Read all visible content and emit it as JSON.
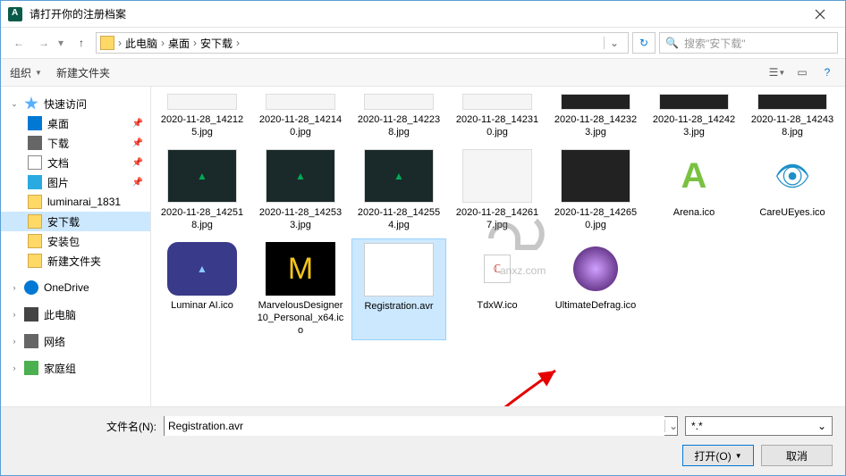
{
  "window": {
    "title": "请打开你的注册档案"
  },
  "nav": {
    "crumbs": [
      "此电脑",
      "桌面",
      "安下载"
    ],
    "search_placeholder": "搜索\"安下载\""
  },
  "toolbar": {
    "organize": "组织",
    "new_folder": "新建文件夹"
  },
  "sidebar": {
    "quick_access": "快速访问",
    "desktop": "桌面",
    "downloads": "下载",
    "documents": "文档",
    "pictures": "图片",
    "luminar": "luminarai_1831",
    "anxiazai": "安下载",
    "install_pkg": "安装包",
    "new_folder": "新建文件夹",
    "onedrive": "OneDrive",
    "this_pc": "此电脑",
    "network": "网络",
    "homegroup": "家庭组"
  },
  "files": {
    "row1": [
      {
        "name": "2020-11-28_142125.jpg"
      },
      {
        "name": "2020-11-28_142140.jpg"
      },
      {
        "name": "2020-11-28_142238.jpg"
      },
      {
        "name": "2020-11-28_142310.jpg"
      },
      {
        "name": "2020-11-28_142323.jpg"
      },
      {
        "name": "2020-11-28_142423.jpg"
      },
      {
        "name": "2020-11-28_142438.jpg"
      }
    ],
    "row2": [
      {
        "name": "2020-11-28_142518.jpg"
      },
      {
        "name": "2020-11-28_142533.jpg"
      },
      {
        "name": "2020-11-28_142554.jpg"
      },
      {
        "name": "2020-11-28_142617.jpg"
      },
      {
        "name": "2020-11-28_142650.jpg"
      },
      {
        "name": "Arena.ico"
      },
      {
        "name": "CareUEyes.ico"
      }
    ],
    "row3": [
      {
        "name": "Luminar AI.ico"
      },
      {
        "name": "MarvelousDesigner10_Personal_x64.ico"
      },
      {
        "name": "Registration.avr",
        "selected": true
      },
      {
        "name": "TdxW.ico"
      },
      {
        "name": "UltimateDefrag.ico"
      }
    ]
  },
  "watermark": {
    "text": "anxz.com"
  },
  "bottom": {
    "filename_label": "文件名(N):",
    "filename_value": "Registration.avr",
    "filter": "*.*",
    "open": "打开(O)",
    "cancel": "取消"
  }
}
